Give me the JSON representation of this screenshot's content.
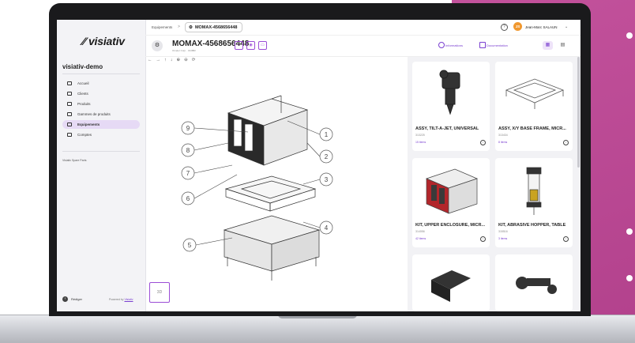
{
  "app": {
    "logo": "visiativ",
    "tenant": "visiativ-demo"
  },
  "sidebar": {
    "items": [
      {
        "label": "Accueil",
        "active": false
      },
      {
        "label": "Clients",
        "active": false
      },
      {
        "label": "Produits",
        "active": false
      },
      {
        "label": "Gammes de produits",
        "active": false
      },
      {
        "label": "Equipements",
        "active": true
      },
      {
        "label": "Comptes",
        "active": false
      }
    ],
    "footer_text": "Visiativ Spare Parts",
    "back_label": "Rédiger",
    "powered_prefix": "Powered by",
    "powered_link": "Visiativ"
  },
  "topbar": {
    "breadcrumb_root": "Equipements",
    "breadcrumb_sep": ">",
    "breadcrumb_current": "MOMAX-4568656448",
    "help_icon": "?",
    "avatar_initials": "JS",
    "user_name": "Jean-Marc SALAUN",
    "user_chevron": "⌄"
  },
  "header": {
    "title": "MOMAX-4568656448",
    "subtitle": "Omeler Corp · 314882",
    "info_label": "Informations",
    "doc_label": "Documentation"
  },
  "toolbar": {
    "icons": [
      "←",
      "→",
      "↑",
      "↓",
      "⊕",
      "⊖",
      "⟳"
    ]
  },
  "viewer": {
    "callouts": [
      "1",
      "2",
      "3",
      "4",
      "5",
      "6",
      "7",
      "8",
      "9"
    ],
    "mini_label": "3D"
  },
  "cards": [
    {
      "title": "ASSY, TILT-A-JET, UNIVERSAL",
      "code": "313225",
      "items": "15 items"
    },
    {
      "title": "ASSY, X/Y BASE FRAME, MICR...",
      "code": "313434",
      "items": "8 items"
    },
    {
      "title": "KIT, UPPER ENCLOSURE, MICR...",
      "code": "314056",
      "items": "42 items"
    },
    {
      "title": "KIT, ABRASIVE HOPPER, TABLE",
      "code": "315516",
      "items": "3 items"
    },
    {
      "title": "",
      "code": "",
      "items": ""
    },
    {
      "title": "",
      "code": "",
      "items": ""
    }
  ],
  "colors": {
    "accent": "#9b4dd6",
    "pink_bg": "#c3529c",
    "avatar": "#f0982f"
  }
}
